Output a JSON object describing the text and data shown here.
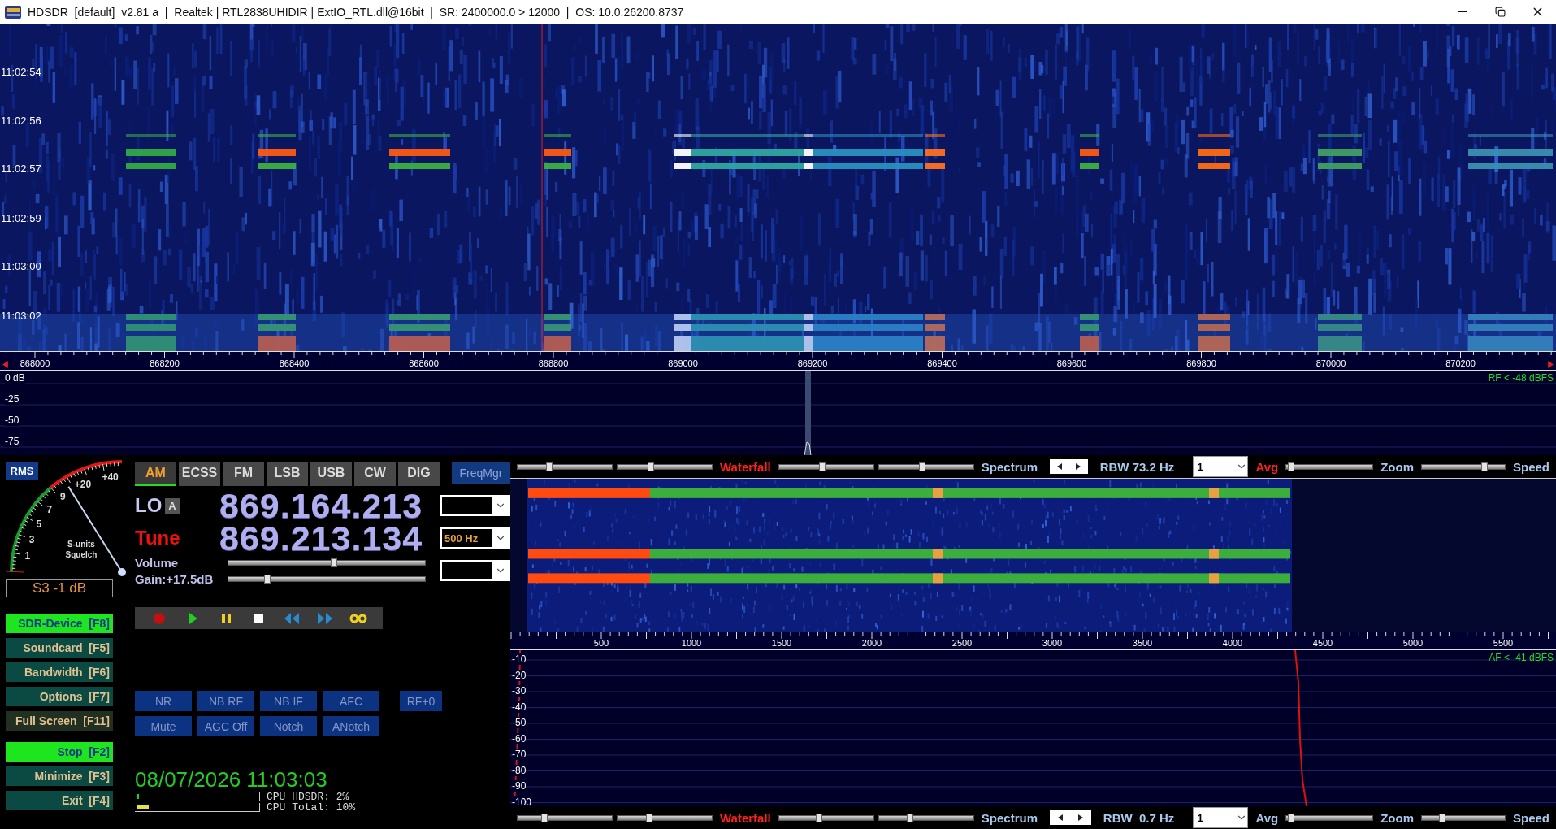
{
  "window": {
    "title": "HDSDR  [default]  v2.81 a  |  Realtek | RTL2838UHIDIR | ExtIO_RTL.dll@16bit  |  SR: 2400000.0 > 12000  |  OS: 10.0.26200.8737"
  },
  "waterfall": {
    "time_labels": [
      "11:02:54",
      "11:02:56",
      "11:02:57",
      "11:02:59",
      "11:03:00",
      "11:03:02"
    ]
  },
  "rf_axis": {
    "labels": [
      "868000",
      "868200",
      "868400",
      "868600",
      "868800",
      "869000",
      "869200",
      "869400",
      "869600",
      "869800",
      "870000",
      "870200"
    ]
  },
  "rf_spectrum": {
    "db_labels": [
      "0 dB",
      "-25",
      "-50",
      "-75"
    ],
    "readout": "RF < -48 dBFS"
  },
  "smeter": {
    "mode": "RMS",
    "scale_labels": [
      "1",
      "3",
      "5",
      "7",
      "9",
      "+20",
      "+40"
    ],
    "caption": [
      "S-units",
      "Squelch"
    ],
    "readout": "S3 -1 dB"
  },
  "side_buttons": [
    {
      "label": "SDR-Device",
      "key": "[F8]",
      "color": "#1ee61e"
    },
    {
      "label": "Soundcard",
      "key": "[F5]",
      "color": "#0b4a42"
    },
    {
      "label": "Bandwidth",
      "key": "[F6]",
      "color": "#0b4a42"
    },
    {
      "label": "Options",
      "key": "[F7]",
      "color": "#0b4a42"
    },
    {
      "label": "Full Screen",
      "key": "[F11]",
      "color": "#223022"
    },
    {
      "label": "Stop",
      "key": "[F2]",
      "color": "#1ee61e"
    },
    {
      "label": "Minimize",
      "key": "[F3]",
      "color": "#0b4a42"
    },
    {
      "label": "Exit",
      "key": "[F4]",
      "color": "#0b4a42"
    }
  ],
  "modes": [
    {
      "label": "AM",
      "selected": true
    },
    {
      "label": "ECSS",
      "selected": false
    },
    {
      "label": "FM",
      "selected": false
    },
    {
      "label": "LSB",
      "selected": false
    },
    {
      "label": "USB",
      "selected": false
    },
    {
      "label": "CW",
      "selected": false
    },
    {
      "label": "DIG",
      "selected": false
    }
  ],
  "freq_manager": "FreqMgr",
  "lo": {
    "label": "LO",
    "badge": "A",
    "frequency": "869.164.213"
  },
  "tune": {
    "label": "Tune",
    "frequency": "869.213.134",
    "step": "500 Hz"
  },
  "volume": {
    "label": "Volume",
    "level": 0.54
  },
  "gain": {
    "label": "Gain:+17.5dB",
    "level": 0.19
  },
  "dsp_rows": [
    [
      "NR",
      "NB RF",
      "NB IF",
      "AFC"
    ],
    [
      "Mute",
      "AGC Off",
      "Notch",
      "ANotch"
    ]
  ],
  "rf_button": "RF+0",
  "clock": "08/07/2026 11:03:03",
  "cpu": [
    {
      "label": "CPU HDSDR: 2%",
      "level": 0.02,
      "color": "#22cc22"
    },
    {
      "label": "CPU Total: 10%",
      "level": 0.1,
      "color": "#e8e040"
    }
  ],
  "upper_toolbar": {
    "sliders": [
      {
        "level": 0.32
      },
      {
        "level": 0.34
      },
      {
        "level": 0.46
      },
      {
        "level": 0.46
      }
    ],
    "waterfall_label": "Waterfall",
    "spectrum_label": "Spectrum",
    "rbw": "RBW 73.2 Hz",
    "avg_value": "1",
    "avg_label": "Avg",
    "avg_on": true,
    "zoom_label": "Zoom",
    "zoom_slider": {
      "level": 0.02
    },
    "speed_label": "Speed",
    "speed_slider": {
      "level": 0.78
    }
  },
  "af_axis": {
    "labels": [
      "500",
      "1000",
      "1500",
      "2000",
      "2500",
      "3000",
      "3500",
      "4000",
      "4500",
      "5000",
      "5500"
    ]
  },
  "af_spectrum": {
    "db_labels": [
      "-10",
      "-20",
      "-30",
      "-40",
      "-50",
      "-60",
      "-70",
      "-80",
      "-90",
      "-100"
    ],
    "readout": "AF < -41 dBFS"
  },
  "lower_toolbar": {
    "sliders": [
      {
        "level": 0.27
      },
      {
        "level": 0.32
      },
      {
        "level": 0.42
      },
      {
        "level": 0.32
      }
    ],
    "waterfall_label": "Waterfall",
    "spectrum_label": "Spectrum",
    "rbw": "RBW  0.7 Hz",
    "avg_value": "1",
    "avg_label": "Avg",
    "avg_on": false,
    "zoom_label": "Zoom",
    "zoom_slider": {
      "level": 0.02
    },
    "speed_label": "Speed",
    "speed_slider": {
      "level": 0.22
    }
  }
}
